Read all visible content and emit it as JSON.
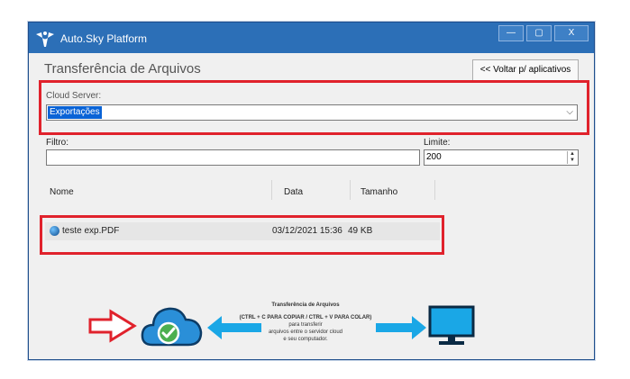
{
  "window": {
    "app_title": "Auto.Sky Platform",
    "buttons": {
      "minimize": "—",
      "maximize": "▢",
      "close": "X"
    }
  },
  "header": {
    "title": "Transferência de Arquivos",
    "back_button": "<< Voltar p/ aplicativos"
  },
  "cloud_server": {
    "label": "Cloud Server:",
    "selected": "Exportações"
  },
  "filter": {
    "label": "Filtro:",
    "value": ""
  },
  "limit": {
    "label": "Limite:",
    "value": "200"
  },
  "table": {
    "columns": [
      "Nome",
      "Data",
      "Tamanho"
    ],
    "rows": [
      {
        "name": "teste exp.PDF",
        "date": "03/12/2021 15:36",
        "size": "49 KB"
      }
    ]
  },
  "instructions": {
    "title": "Transferência de Arquivos",
    "bold_line": "(CTRL + C PARA COPIAR / CTRL + V PARA COLAR)",
    "lines": [
      "para transferir",
      "arquivos entre o servidor cloud",
      "e seu computador."
    ]
  },
  "colors": {
    "titlebar": "#2c6fb7",
    "highlight_box": "#e0222c",
    "cloud": "#2a8fd8",
    "arrow": "#1aa7e6",
    "monitor": "#1aa7e6",
    "check": "#4caf50"
  },
  "icons": [
    "app-logo-icon",
    "cloud-check-icon",
    "left-arrow-icon",
    "right-arrow-icon",
    "monitor-icon",
    "red-outline-arrow-icon",
    "globe-file-icon"
  ]
}
